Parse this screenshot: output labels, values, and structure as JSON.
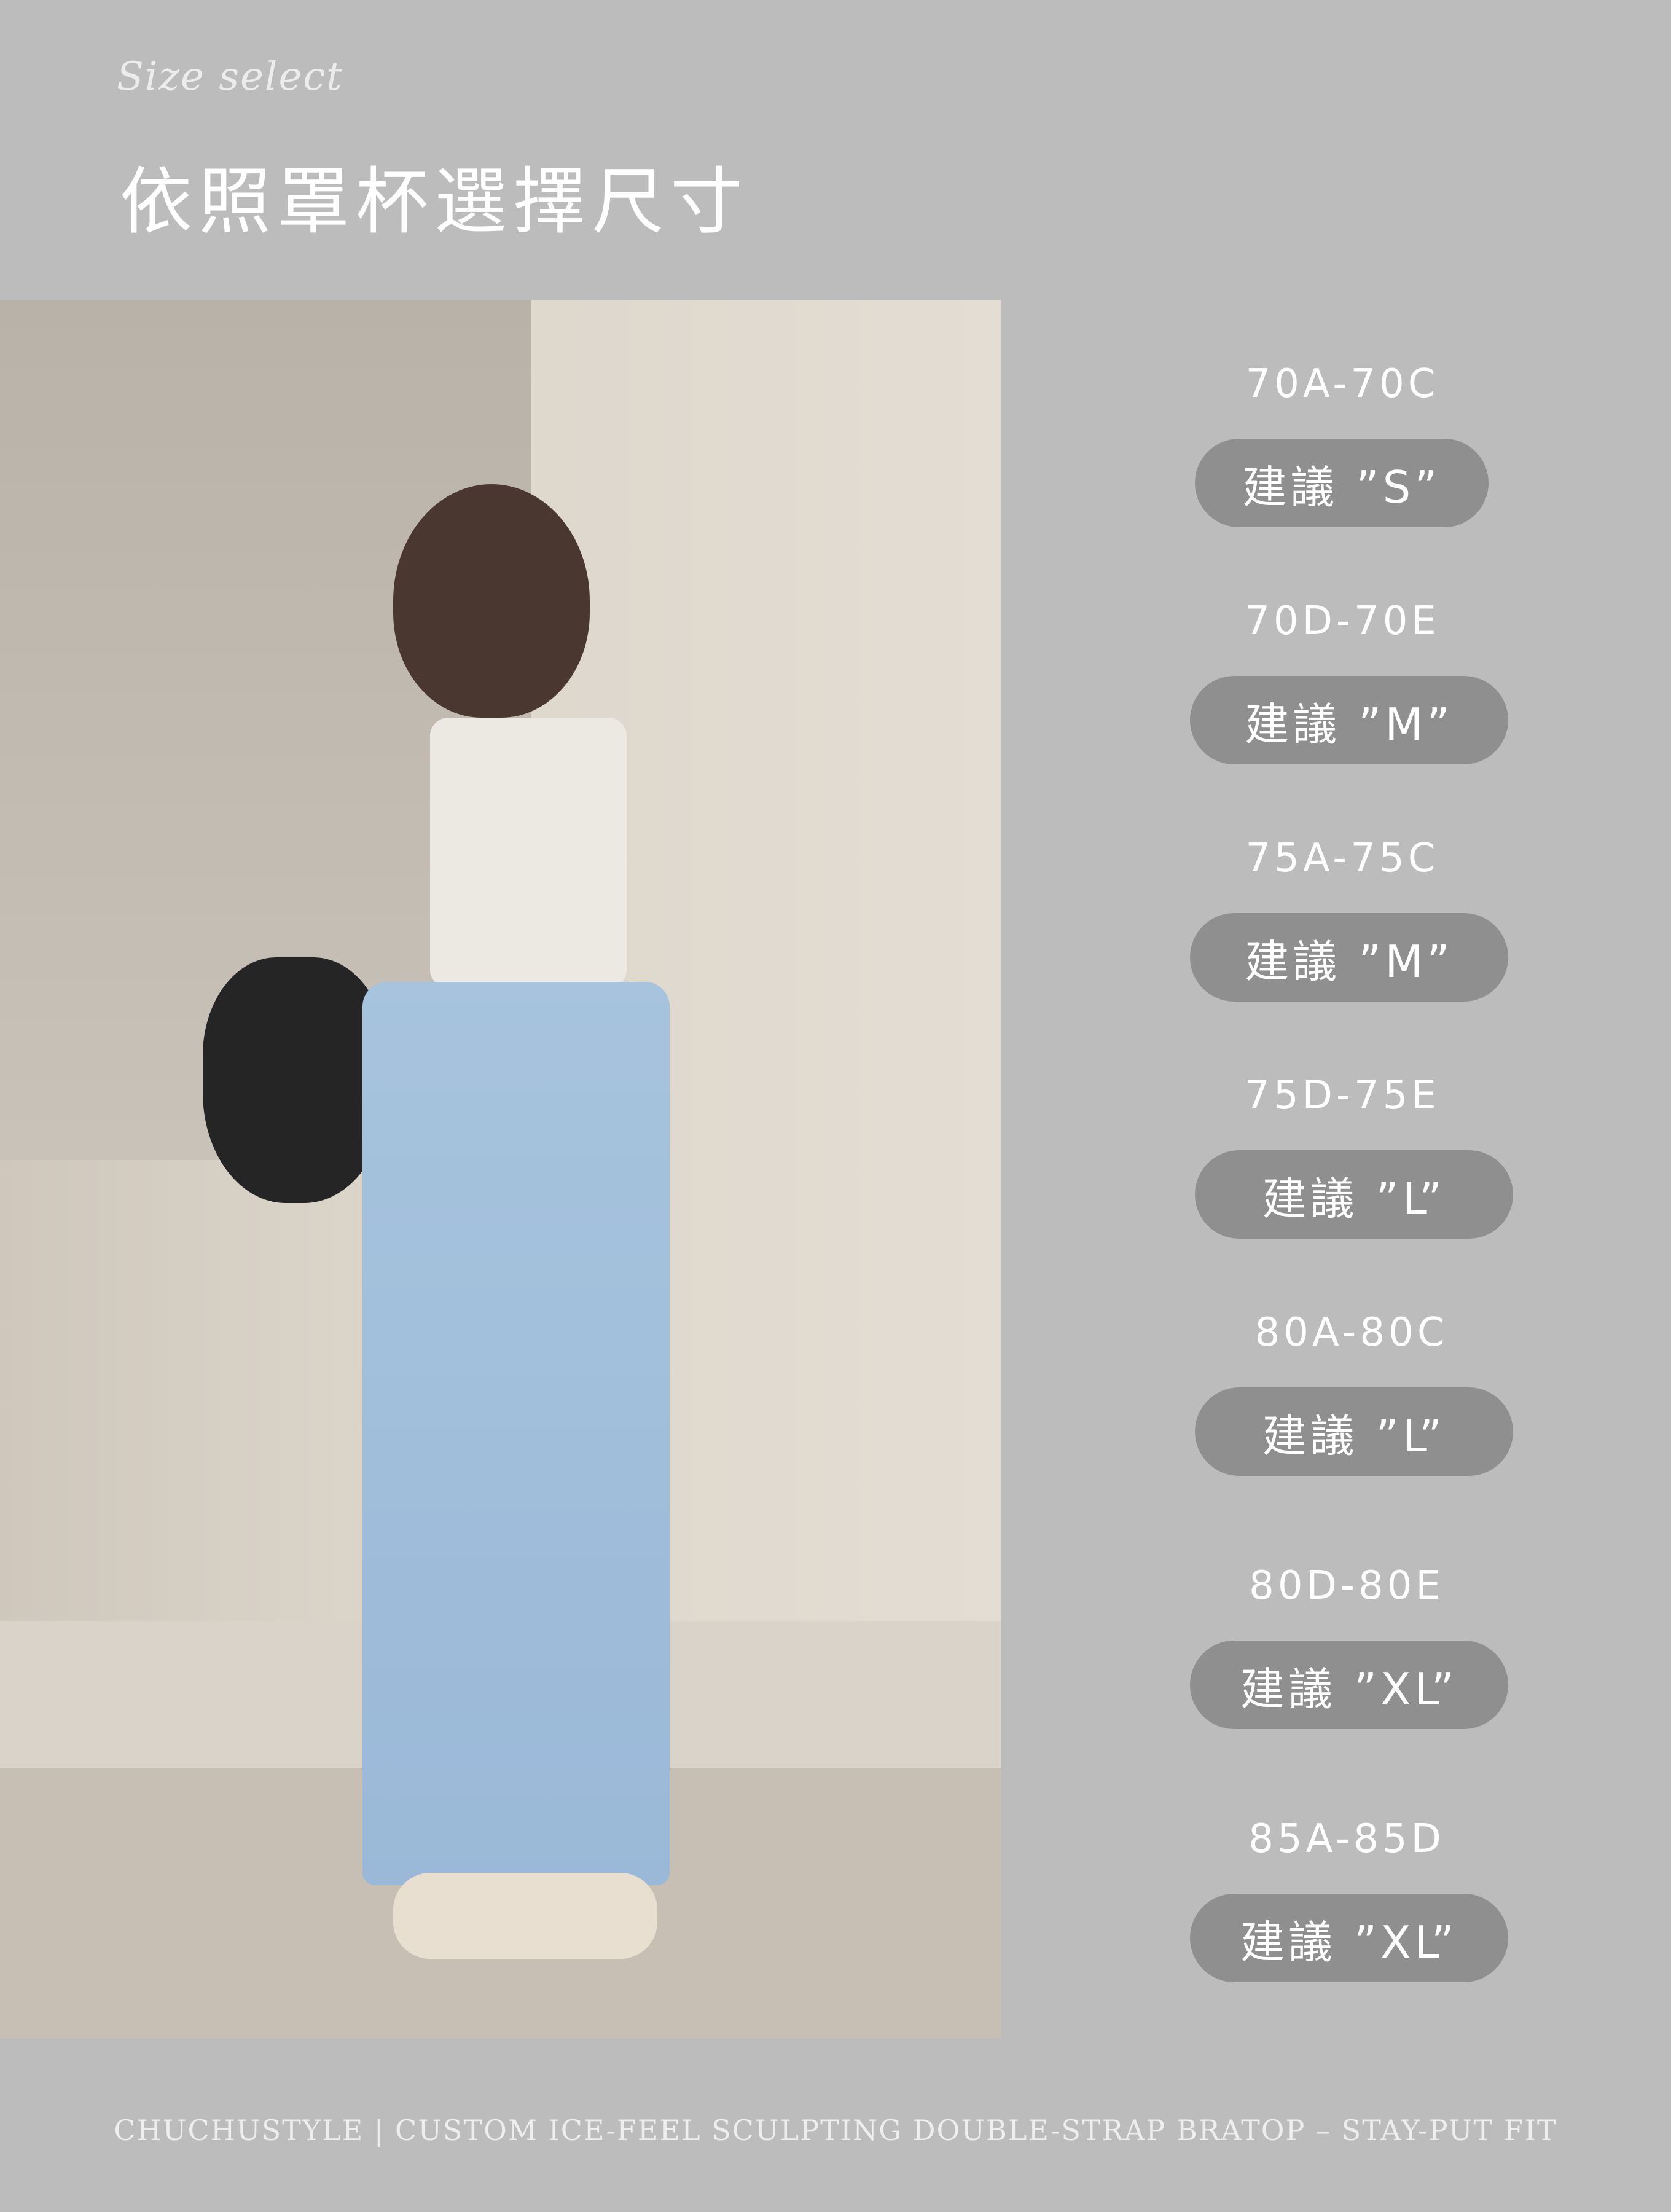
{
  "header": {
    "subtitle": "Size select",
    "title": "依照罩杯選擇尺寸"
  },
  "sizes": [
    {
      "range": "70A-70C",
      "suggestion": "建議 ”S”"
    },
    {
      "range": "70D-70E",
      "suggestion": "建議 ”M”"
    },
    {
      "range": "75A-75C",
      "suggestion": "建議 ”M”"
    },
    {
      "range": "75D-75E",
      "suggestion": "建議 ”L”"
    },
    {
      "range": "80A-80C",
      "suggestion": "建議 ”L”"
    },
    {
      "range": "80D-80E",
      "suggestion": "建議 ”XL”"
    },
    {
      "range": "85A-85D",
      "suggestion": "建議 ”XL”"
    }
  ],
  "footer": {
    "text": "CHUCHUSTYLE | CUSTOM ICE-FEEL SCULPTING DOUBLE-STRAP BRATOP – STAY-PUT FIT"
  },
  "colors": {
    "background": "#bcbcbc",
    "pill": "#8f8f8f",
    "text": "#ffffff"
  }
}
